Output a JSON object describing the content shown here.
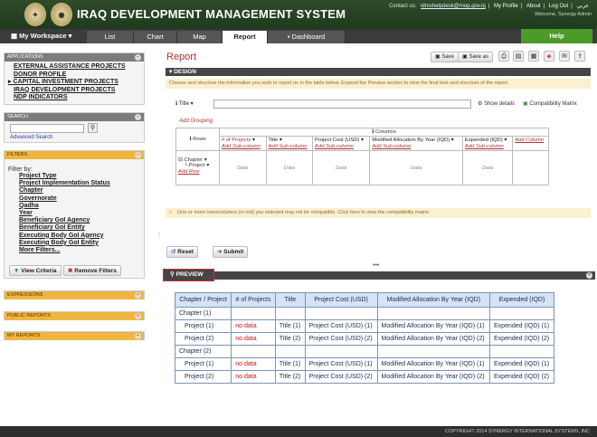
{
  "header": {
    "title": "IRAQ DEVELOPMENT MANAGEMENT SYSTEM",
    "contact_label": "Contact us:",
    "contact_email": "idmshelpdesk@mop.gov.iq",
    "links": [
      "My Profile",
      "About",
      "Log Out",
      "عربي"
    ],
    "welcome": "Welcome, Synergy Admin"
  },
  "nav": {
    "workspace": "My Workspace",
    "tabs": [
      "List",
      "Chart",
      "Map",
      "Report",
      "Dashboard"
    ],
    "help": "Help"
  },
  "sidebar": {
    "applications": {
      "title": "APPLICATIONS",
      "items": [
        "EXTERNAL ASSISTANCE PROJECTS",
        "DONOR PROFILE",
        "CAPITAL INVESTMENT PROJECTS",
        "IRAQ DEVELOPMENT PROJECTS",
        "NDP INDICATORS"
      ]
    },
    "search": {
      "title": "SEARCH",
      "advanced": "Advanced Search"
    },
    "filters": {
      "title": "FILTERS",
      "filter_by": "Filter by:",
      "items": [
        "Project Type",
        "Project Implementation Status",
        "Chapter",
        "Governorate",
        "Qadha",
        "Year",
        "Beneficiary GoI Agency",
        "Beneficiary GoI Entity",
        "Executing Body GoI Agency",
        "Executing Body GoI Entity",
        "More Filters..."
      ],
      "view_criteria": "View Criteria",
      "remove_filters": "Remove Filters"
    },
    "expressions": "EXPRESSIONS",
    "public_reports": "PUBLIC REPORTS",
    "my_reports": "MY REPORTS"
  },
  "report": {
    "title": "Report",
    "save": "Save",
    "save_as": "Save as",
    "design": {
      "title": "DESIGN",
      "note": "Choose and structure the information you wish to report on in the table below. Expand the Preview section to view the final look and structure of the report.",
      "title_label": "Title",
      "show_details": "Show details",
      "compat": "Compatibility Matrix",
      "add_grouping": "Add Grouping",
      "columns": "Columns",
      "rows": "Rows",
      "col_headers": [
        "# of Projects",
        "Title",
        "Project Cost (USD)",
        "Modified Allocation By Year (IQD)",
        "Expended (IQD)",
        "Add Column"
      ],
      "add_sub": "Add Sub-column",
      "row_items": [
        "Chapter",
        "Project"
      ],
      "add_row": "Add Row",
      "data": "Data"
    },
    "warn": "One or more rows/columns (in red) you selected may not be compatible. Click here to view the compatibility matrix.",
    "reset": "Reset",
    "submit": "Submit",
    "preview": {
      "title": "PREVIEW",
      "headers": [
        "Chapter / Project",
        "# of Projects",
        "Title",
        "Project Cost (USD)",
        "Modified Allocation By Year (IQD)",
        "Expended (IQD)"
      ],
      "groups": [
        {
          "name": "Chapter (1)",
          "rows": [
            [
              "Project (1)",
              "no data",
              "Title (1)",
              "Project Cost (USD) (1)",
              "Modified Allocation By Year (IQD) (1)",
              "Expended (IQD) (1)"
            ],
            [
              "Project (2)",
              "no data",
              "Title (2)",
              "Project Cost (USD) (2)",
              "Modified Allocation By Year (IQD) (2)",
              "Expended (IQD) (2)"
            ]
          ]
        },
        {
          "name": "Chapter (2)",
          "rows": [
            [
              "Project (1)",
              "no data",
              "Title (1)",
              "Project Cost (USD) (1)",
              "Modified Allocation By Year (IQD) (1)",
              "Expended (IQD) (1)"
            ],
            [
              "Project (2)",
              "no data",
              "Title (2)",
              "Project Cost (USD) (2)",
              "Modified Allocation By Year (IQD) (2)",
              "Expended (IQD) (2)"
            ]
          ]
        }
      ]
    }
  },
  "footer": "COPYRIGHT 2014 SYNERGY INTERNATIONAL SYSTEMS, INC"
}
